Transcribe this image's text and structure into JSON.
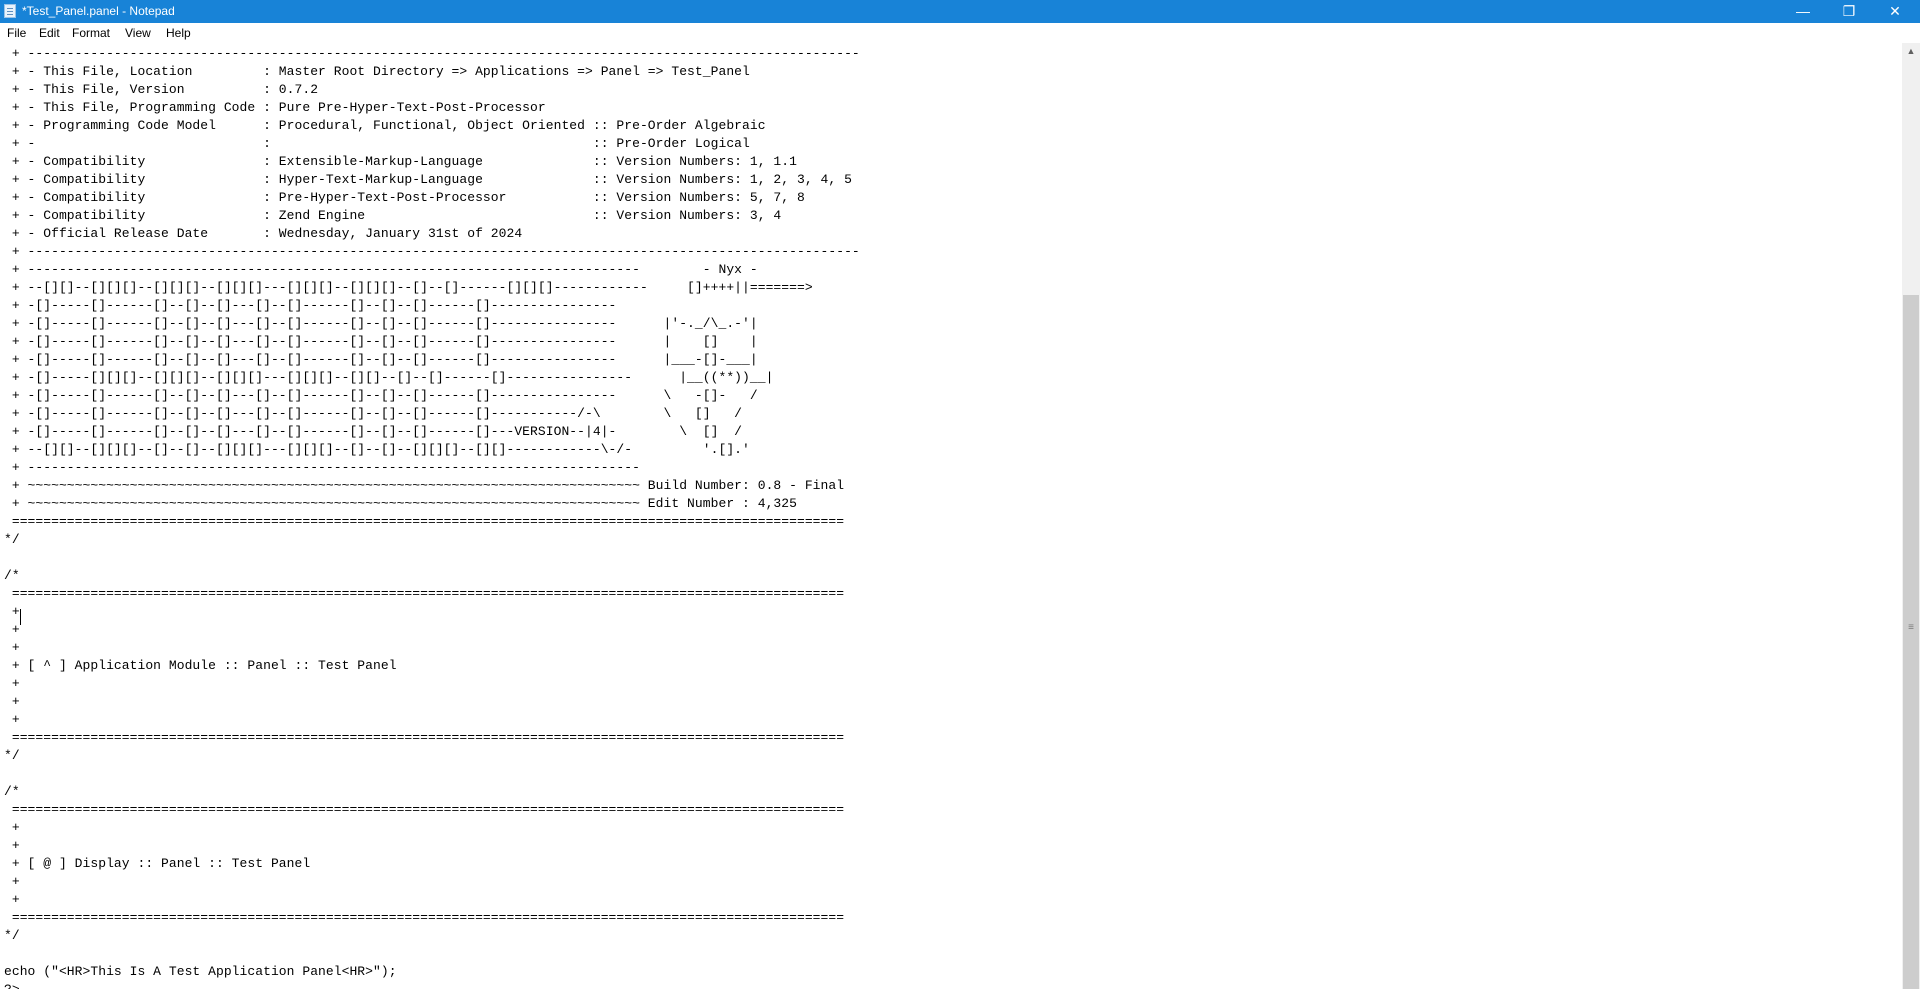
{
  "window": {
    "title": "*Test_Panel.panel - Notepad",
    "icon": "notepad-icon",
    "controls": {
      "minimize": "—",
      "maximize": "❐",
      "close": "✕"
    }
  },
  "menu": [
    "File",
    "Edit",
    "Format",
    "View",
    "Help"
  ],
  "editor": {
    "content": " + ----------------------------------------------------------------------------------------------------------\n + - This File, Location         : Master Root Directory => Applications => Panel => Test_Panel\n + - This File, Version          : 0.7.2\n + - This File, Programming Code : Pure Pre-Hyper-Text-Post-Processor\n + - Programming Code Model      : Procedural, Functional, Object Oriented :: Pre-Order Algebraic\n + -                             :                                         :: Pre-Order Logical\n + - Compatibility               : Extensible-Markup-Language              :: Version Numbers: 1, 1.1\n + - Compatibility               : Hyper-Text-Markup-Language              :: Version Numbers: 1, 2, 3, 4, 5\n + - Compatibility               : Pre-Hyper-Text-Post-Processor           :: Version Numbers: 5, 7, 8\n + - Compatibility               : Zend Engine                             :: Version Numbers: 3, 4\n + - Official Release Date       : Wednesday, January 31st of 2024\n + ----------------------------------------------------------------------------------------------------------\n + ------------------------------------------------------------------------------        - Nyx -\n + --[][]--[][][]--[][][]--[][][]---[][][]--[][][]--[]--[]------[][][]------------     []++++||=======>\n + -[]-----[]------[]--[]--[]---[]--[]------[]--[]--[]------[]----------------\n + -[]-----[]------[]--[]--[]---[]--[]------[]--[]--[]------[]----------------      |'-._/\\_.-'|\n + -[]-----[]------[]--[]--[]---[]--[]------[]--[]--[]------[]----------------      |    []    |\n + -[]-----[]------[]--[]--[]---[]--[]------[]--[]--[]------[]----------------      |___-[]-___|\n + -[]-----[][][]--[][][]--[][][]---[][][]--[][]--[]--[]------[]----------------      |__((**))__|\n + -[]-----[]------[]--[]--[]---[]--[]------[]--[]--[]------[]----------------      \\   -[]-   /\n + -[]-----[]------[]--[]--[]---[]--[]------[]--[]--[]------[]-----------/-\\        \\   []   /\n + -[]-----[]------[]--[]--[]---[]--[]------[]--[]--[]------[]---VERSION--|4|-        \\  []  /\n + --[][]--[][][]--[]--[]--[][][]---[][][]--[]--[]--[][][]--[][]------------\\-/-         '.[].'\n + ------------------------------------------------------------------------------\n + ~~~~~~~~~~~~~~~~~~~~~~~~~~~~~~~~~~~~~~~~~~~~~~~~~~~~~~~~~~~~~~~~~~~~~~~~~~~~~~ Build Number: 0.8 - Final\n + ~~~~~~~~~~~~~~~~~~~~~~~~~~~~~~~~~~~~~~~~~~~~~~~~~~~~~~~~~~~~~~~~~~~~~~~~~~~~~~ Edit Number : 4,325\n ==========================================================================================================\n*/\n\n/*\n ==========================================================================================================\n +\n +\n +\n + [ ^ ] Application Module :: Panel :: Test Panel\n +\n +\n +\n ==========================================================================================================\n*/\n\n/*\n ==========================================================================================================\n +\n +\n + [ @ ] Display :: Panel :: Test Panel\n +\n +\n ==========================================================================================================\n*/\n\necho (\"<HR>This Is A Test Application Panel<HR>\");\n?>"
  }
}
